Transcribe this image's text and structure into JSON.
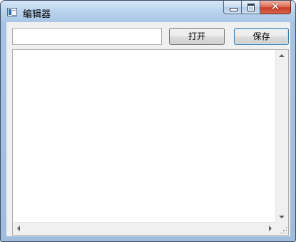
{
  "window": {
    "title": "编辑器",
    "icon": "app-window-icon",
    "controls": {
      "minimize_icon": "minimize-icon",
      "maximize_icon": "maximize-icon",
      "close_icon": "close-icon",
      "close_glyph": "✕"
    }
  },
  "toolbar": {
    "path_value": "",
    "path_placeholder": "",
    "open_label": "打开",
    "save_label": "保存"
  },
  "editor": {
    "content": ""
  }
}
